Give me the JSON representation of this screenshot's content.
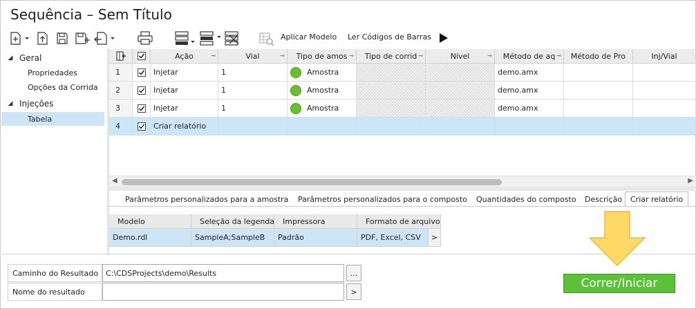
{
  "window": {
    "title": "Sequência – Sem Título"
  },
  "toolbar": {
    "apply_template": "Aplicar Modelo",
    "read_barcodes": "Ler Códigos de Barras"
  },
  "nav": {
    "groups": [
      {
        "label": "Geral",
        "items": [
          "Propriedades",
          "Opções da Corrida"
        ]
      },
      {
        "label": "Injeções",
        "items": [
          "Tabela"
        ]
      }
    ],
    "selected": "Tabela"
  },
  "grid": {
    "columns": [
      "Ação",
      "Vial",
      "Tipo de amos",
      "Tipo de corrid",
      "Nível",
      "Método de aq",
      "Método de Pro",
      "Inj/Vial"
    ],
    "rows": [
      {
        "num": "1",
        "action": "Injetar",
        "vial": "1",
        "sample_type": "Amostra",
        "method": "demo.amx"
      },
      {
        "num": "2",
        "action": "Injetar",
        "vial": "1",
        "sample_type": "Amostra",
        "method": "demo.amx"
      },
      {
        "num": "3",
        "action": "Injetar",
        "vial": "1",
        "sample_type": "Amostra",
        "method": "demo.amx"
      },
      {
        "num": "4",
        "action": "Criar relatório",
        "vial": "",
        "sample_type": "",
        "method": ""
      }
    ]
  },
  "tabs": [
    "Parâmetros personalizados para a amostra",
    "Parâmetros personalizados para o composto",
    "Quantidades do composto",
    "Descrição",
    "Criar relatório"
  ],
  "active_tab": "Criar relatório",
  "report_table": {
    "columns": [
      "Modelo",
      "Seleção da legenda",
      "Impressora",
      "Formato de arquivo"
    ],
    "row": [
      "Demo.rdl",
      "SampleA;SampleB",
      "Padrão",
      "PDF, Excel, CSV"
    ],
    "more_button": ">"
  },
  "form": {
    "result_path_label": "Caminho do Resultado",
    "result_path_value": "C:\\CDSProjects\\demo\\Results",
    "browse_button": "...",
    "result_name_label": "Nome do resultado",
    "result_name_value": "",
    "name_button": ">"
  },
  "run_button": {
    "label": "Correr/Iniciar"
  },
  "colors": {
    "accent_selected": "#cde6f7",
    "run_green": "#5cc138",
    "sample_dot": "#6cbf2c",
    "hint_arrow": "#ffd966"
  }
}
